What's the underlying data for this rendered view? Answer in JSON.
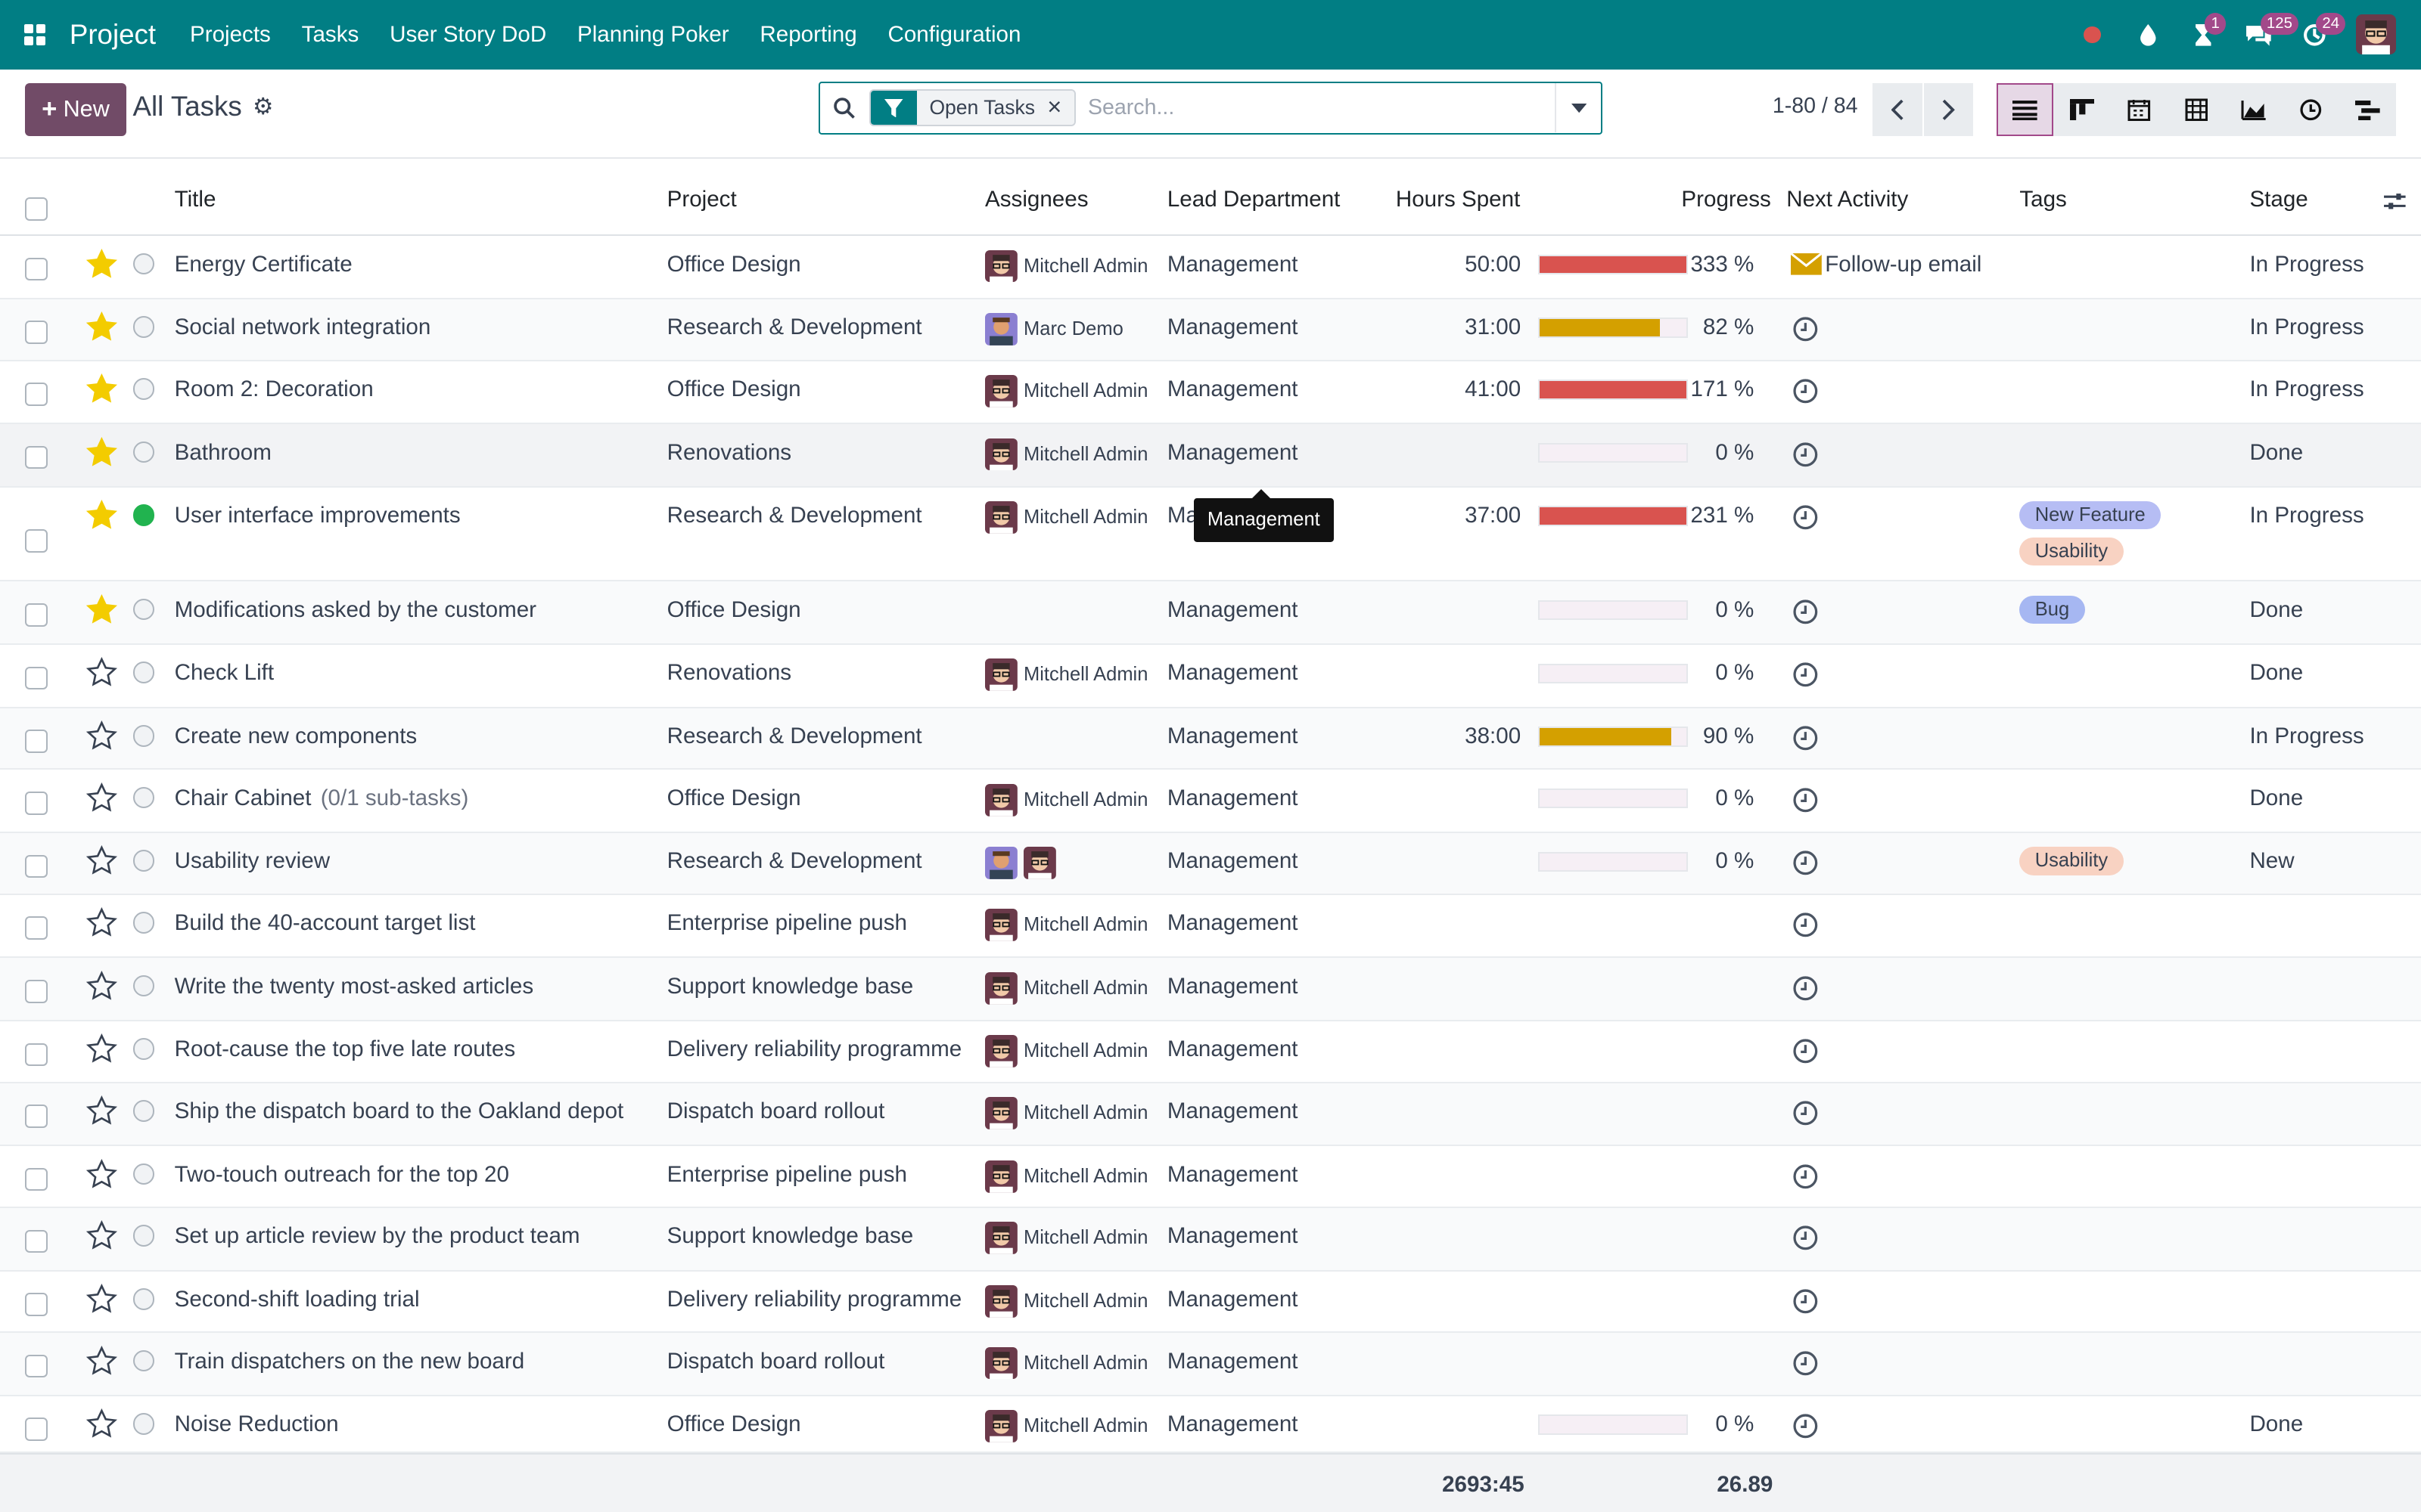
{
  "navbar": {
    "app_name": "Project",
    "menu": [
      "Projects",
      "Tasks",
      "User Story DoD",
      "Planning Poker",
      "Reporting",
      "Configuration"
    ],
    "activity_badge": "1",
    "messages_badge": "125",
    "updates_badge": "24",
    "accent": "#017e84"
  },
  "control_panel": {
    "new_label": "New",
    "breadcrumb": "All Tasks",
    "facet_label": "Open Tasks",
    "search_placeholder": "Search...",
    "pager": "1-80 / 84"
  },
  "columns": {
    "title": "Title",
    "project": "Project",
    "assignees": "Assignees",
    "lead_department": "Lead Department",
    "hours_spent": "Hours Spent",
    "progress": "Progress",
    "next_activity": "Next Activity",
    "tags": "Tags",
    "stage": "Stage"
  },
  "rows": [
    {
      "title": "Energy Certificate",
      "subtasks": "",
      "project": "Office Design",
      "assignee": "Mitchell Admin",
      "dept": "Management",
      "hours": "50:00",
      "progress": 333,
      "progress_label": "333 %",
      "activity": "Follow-up email",
      "tags": [],
      "stage": "In Progress",
      "starred": true,
      "status": "normal"
    },
    {
      "title": "Social network integration",
      "subtasks": "",
      "project": "Research & Development",
      "assignee": "Marc Demo",
      "dept": "Management",
      "hours": "31:00",
      "progress": 82,
      "progress_label": "82 %",
      "activity": "",
      "tags": [],
      "stage": "In Progress",
      "starred": true,
      "status": "normal"
    },
    {
      "title": "Room 2: Decoration",
      "subtasks": "",
      "project": "Office Design",
      "assignee": "Mitchell Admin",
      "dept": "Management",
      "hours": "41:00",
      "progress": 171,
      "progress_label": "171 %",
      "activity": "",
      "tags": [],
      "stage": "In Progress",
      "starred": true,
      "status": "normal"
    },
    {
      "title": "Bathroom",
      "subtasks": "",
      "project": "Renovations",
      "assignee": "Mitchell Admin",
      "dept": "Management",
      "hours": "",
      "progress": 0,
      "progress_label": "0 %",
      "activity": "",
      "tags": [],
      "stage": "Done",
      "starred": true,
      "status": "normal"
    },
    {
      "title": "User interface improvements",
      "subtasks": "",
      "project": "Research & Development",
      "assignee": "Mitchell Admin",
      "dept": "Ma",
      "hours": "37:00",
      "progress": 231,
      "progress_label": "231 %",
      "activity": "",
      "tags": [
        "New Feature",
        "Usability"
      ],
      "stage": "In Progress",
      "starred": true,
      "status": "done"
    },
    {
      "title": "Modifications asked by the customer",
      "subtasks": "",
      "project": "Office Design",
      "assignee": "",
      "dept": "Management",
      "hours": "",
      "progress": 0,
      "progress_label": "0 %",
      "activity": "",
      "tags": [
        "Bug"
      ],
      "stage": "Done",
      "starred": true,
      "status": "normal"
    },
    {
      "title": "Check Lift",
      "subtasks": "",
      "project": "Renovations",
      "assignee": "Mitchell Admin",
      "dept": "Management",
      "hours": "",
      "progress": 0,
      "progress_label": "0 %",
      "activity": "",
      "tags": [],
      "stage": "Done",
      "starred": false,
      "status": "normal"
    },
    {
      "title": "Create new components",
      "subtasks": "",
      "project": "Research & Development",
      "assignee": "",
      "dept": "Management",
      "hours": "38:00",
      "progress": 90,
      "progress_label": "90 %",
      "activity": "",
      "tags": [],
      "stage": "In Progress",
      "starred": false,
      "status": "normal"
    },
    {
      "title": "Chair Cabinet",
      "subtasks": "(0/1 sub-tasks)",
      "project": "Office Design",
      "assignee": "Mitchell Admin",
      "dept": "Management",
      "hours": "",
      "progress": 0,
      "progress_label": "0 %",
      "activity": "",
      "tags": [],
      "stage": "Done",
      "starred": false,
      "status": "normal"
    },
    {
      "title": "Usability review",
      "subtasks": "",
      "project": "Research & Development",
      "assignee": "",
      "dept": "Management",
      "hours": "",
      "progress": 0,
      "progress_label": "0 %",
      "activity": "",
      "tags": [
        "Usability"
      ],
      "stage": "New",
      "starred": false,
      "status": "normal",
      "multi_avatar": true
    },
    {
      "title": "Build the 40-account target list",
      "subtasks": "",
      "project": "Enterprise pipeline push",
      "assignee": "Mitchell Admin",
      "dept": "Management",
      "hours": "",
      "progress": null,
      "progress_label": "",
      "activity": "",
      "tags": [],
      "stage": "",
      "starred": false,
      "status": "normal"
    },
    {
      "title": "Write the twenty most-asked articles",
      "subtasks": "",
      "project": "Support knowledge base",
      "assignee": "Mitchell Admin",
      "dept": "Management",
      "hours": "",
      "progress": null,
      "progress_label": "",
      "activity": "",
      "tags": [],
      "stage": "",
      "starred": false,
      "status": "normal"
    },
    {
      "title": "Root-cause the top five late routes",
      "subtasks": "",
      "project": "Delivery reliability programme",
      "assignee": "Mitchell Admin",
      "dept": "Management",
      "hours": "",
      "progress": null,
      "progress_label": "",
      "activity": "",
      "tags": [],
      "stage": "",
      "starred": false,
      "status": "normal"
    },
    {
      "title": "Ship the dispatch board to the Oakland depot",
      "subtasks": "",
      "project": "Dispatch board rollout",
      "assignee": "Mitchell Admin",
      "dept": "Management",
      "hours": "",
      "progress": null,
      "progress_label": "",
      "activity": "",
      "tags": [],
      "stage": "",
      "starred": false,
      "status": "normal"
    },
    {
      "title": "Two-touch outreach for the top 20",
      "subtasks": "",
      "project": "Enterprise pipeline push",
      "assignee": "Mitchell Admin",
      "dept": "Management",
      "hours": "",
      "progress": null,
      "progress_label": "",
      "activity": "",
      "tags": [],
      "stage": "",
      "starred": false,
      "status": "normal"
    },
    {
      "title": "Set up article review by the product team",
      "subtasks": "",
      "project": "Support knowledge base",
      "assignee": "Mitchell Admin",
      "dept": "Management",
      "hours": "",
      "progress": null,
      "progress_label": "",
      "activity": "",
      "tags": [],
      "stage": "",
      "starred": false,
      "status": "normal"
    },
    {
      "title": "Second-shift loading trial",
      "subtasks": "",
      "project": "Delivery reliability programme",
      "assignee": "Mitchell Admin",
      "dept": "Management",
      "hours": "",
      "progress": null,
      "progress_label": "",
      "activity": "",
      "tags": [],
      "stage": "",
      "starred": false,
      "status": "normal"
    },
    {
      "title": "Train dispatchers on the new board",
      "subtasks": "",
      "project": "Dispatch board rollout",
      "assignee": "Mitchell Admin",
      "dept": "Management",
      "hours": "",
      "progress": null,
      "progress_label": "",
      "activity": "",
      "tags": [],
      "stage": "",
      "starred": false,
      "status": "normal"
    },
    {
      "title": "Noise Reduction",
      "subtasks": "",
      "project": "Office Design",
      "assignee": "Mitchell Admin",
      "dept": "Management",
      "hours": "",
      "progress": 0,
      "progress_label": "0 %",
      "activity": "",
      "tags": [],
      "stage": "Done",
      "starred": false,
      "status": "normal"
    }
  ],
  "tooltip": "Management",
  "footer": {
    "hours_total": "2693:45",
    "progress_avg": "26.89"
  },
  "colors": {
    "over": "#d9534f",
    "mid": "#d4a000",
    "star": "#f3cc00",
    "tag_new_feature": "#b6bdf4",
    "tag_usability": "#f8d2c2",
    "tag_bug": "#a6b7f2"
  }
}
